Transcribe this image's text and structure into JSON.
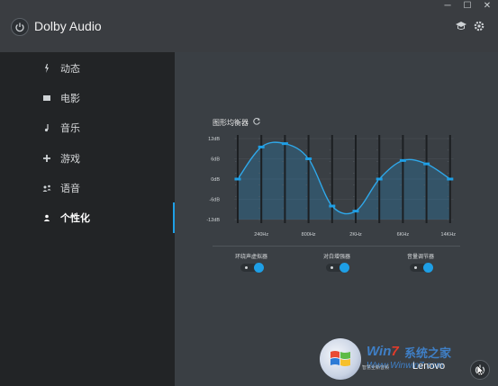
{
  "window": {
    "minimize": "─",
    "maximize": "☐",
    "close": "✕"
  },
  "header": {
    "title": "Dolby Audio",
    "logo_icon": "power-icon",
    "icons": [
      "graduation-cap-icon",
      "gear-icon"
    ]
  },
  "sidebar": {
    "items": [
      {
        "label": "动态",
        "icon": "lightning-icon"
      },
      {
        "label": "电影",
        "icon": "film-icon"
      },
      {
        "label": "音乐",
        "icon": "music-note-icon"
      },
      {
        "label": "游戏",
        "icon": "gamepad-icon"
      },
      {
        "label": "语音",
        "icon": "people-icon"
      },
      {
        "label": "个性化",
        "icon": "person-icon",
        "active": true
      }
    ]
  },
  "equalizer": {
    "title": "图形均衡器",
    "db_labels": [
      "12dB",
      "6dB",
      "0dB",
      "-6dB",
      "-12dB"
    ],
    "freq_labels": [
      "240Hz",
      "800Hz",
      "2KHz",
      "6KHz",
      "14KHz"
    ],
    "band_gains_db": [
      0,
      9.5,
      10.5,
      6,
      -8,
      -9.5,
      0,
      5.5,
      4.5,
      0
    ],
    "curve_color": "#1e9fe6"
  },
  "toggles": [
    {
      "label": "环绕声虚拟器",
      "on": true
    },
    {
      "label": "对白增强器",
      "on": true
    },
    {
      "label": "音量调节器",
      "on": true
    }
  ],
  "watermark": {
    "brand": "Win",
    "brand_seven": "7",
    "cn": "系统之家",
    "url": "Www.Winwin7.com"
  },
  "footer": {
    "small_text": "智慧全新音频",
    "brand": "Lenovo"
  },
  "colors": {
    "accent": "#1e9fe6",
    "sidebar_bg": "#222426",
    "main_bg": "#3a3f44"
  }
}
